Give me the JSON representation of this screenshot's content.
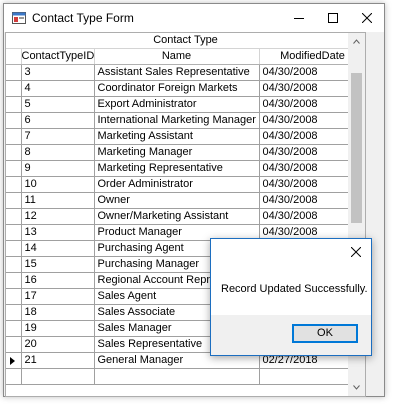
{
  "window": {
    "title": "Contact Type Form"
  },
  "grid": {
    "caption": "Contact Type",
    "columns": [
      "ContactTypeID",
      "Name",
      "ModifiedDate"
    ],
    "rows": [
      [
        "3",
        "Assistant Sales Representative",
        "04/30/2008"
      ],
      [
        "4",
        "Coordinator Foreign Markets",
        "04/30/2008"
      ],
      [
        "5",
        "Export Administrator",
        "04/30/2008"
      ],
      [
        "6",
        "International Marketing Manager",
        "04/30/2008"
      ],
      [
        "7",
        "Marketing Assistant",
        "04/30/2008"
      ],
      [
        "8",
        "Marketing Manager",
        "04/30/2008"
      ],
      [
        "9",
        "Marketing Representative",
        "04/30/2008"
      ],
      [
        "10",
        "Order Administrator",
        "04/30/2008"
      ],
      [
        "11",
        "Owner",
        "04/30/2008"
      ],
      [
        "12",
        "Owner/Marketing Assistant",
        "04/30/2008"
      ],
      [
        "13",
        "Product Manager",
        "04/30/2008"
      ],
      [
        "14",
        "Purchasing Agent",
        ""
      ],
      [
        "15",
        "Purchasing Manager",
        ""
      ],
      [
        "16",
        "Regional Account Representa",
        ""
      ],
      [
        "17",
        "Sales Agent",
        ""
      ],
      [
        "18",
        "Sales Associate",
        ""
      ],
      [
        "19",
        "Sales Manager",
        ""
      ],
      [
        "20",
        "Sales Representative",
        ""
      ],
      [
        "21",
        "General Manager",
        "02/27/2018"
      ],
      [
        "",
        "",
        ""
      ]
    ],
    "current_row_index": 18
  },
  "dialog": {
    "message": "Record Updated Successfully.",
    "ok_label": "OK"
  }
}
